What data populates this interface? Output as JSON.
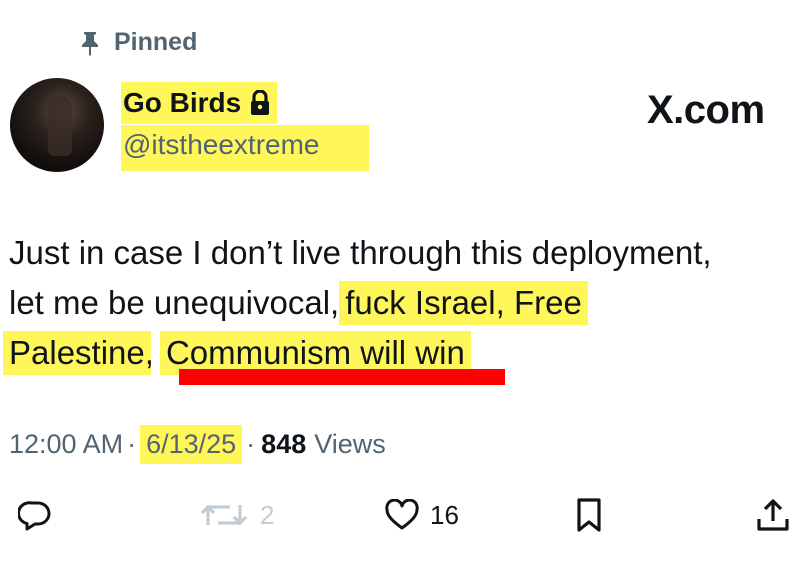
{
  "pinned": {
    "label": "Pinned"
  },
  "author": {
    "name": "Go Birds",
    "handle": "@itstheextreme",
    "locked": true
  },
  "watermark": "X.com",
  "tweet": {
    "line1": "Just in case I don’t live through this deployment,",
    "line2_plain": "let me be unequivocal,",
    "line2_hl": "fuck Israel, Free",
    "line3_hl1": "Palestine",
    "line3_sep": ",",
    "line3_hl2": "Communism will win"
  },
  "meta": {
    "time": "12:00 AM",
    "sep1": "·",
    "date": "6/13/25",
    "sep2": "·",
    "views_count": "848",
    "views_label": "Views"
  },
  "actions": {
    "reply_count": "",
    "retweet_count": "2",
    "like_count": "16"
  },
  "colors": {
    "highlight": "#fff65a",
    "underline": "#ff0000",
    "secondary_text": "#536471"
  },
  "icons": [
    "pin-icon",
    "lock-icon",
    "reply-icon",
    "retweet-icon",
    "like-icon",
    "bookmark-icon",
    "share-icon"
  ]
}
